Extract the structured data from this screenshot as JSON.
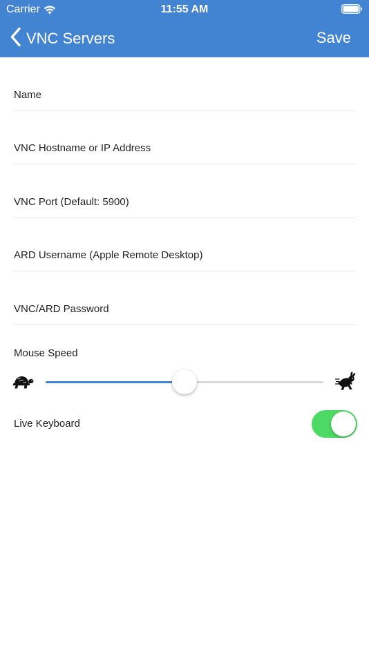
{
  "status_bar": {
    "carrier": "Carrier",
    "time": "11:55 AM",
    "wifi_icon": "wifi-icon",
    "battery_icon": "battery-icon"
  },
  "nav": {
    "back_label": "VNC Servers",
    "back_icon": "chevron-left-icon",
    "save_label": "Save",
    "bar_color": "#4384d2"
  },
  "form": {
    "name": {
      "placeholder": "Name",
      "value": ""
    },
    "hostname": {
      "placeholder": "VNC Hostname or IP Address",
      "value": ""
    },
    "port": {
      "placeholder": "VNC Port (Default: 5900)",
      "value": ""
    },
    "ard_username": {
      "placeholder": "ARD Username (Apple Remote Desktop)",
      "value": ""
    },
    "password": {
      "placeholder": "VNC/ARD Password",
      "value": ""
    }
  },
  "mouse_speed": {
    "label": "Mouse Speed",
    "value": 0.5,
    "min_icon": "turtle-icon",
    "max_icon": "rabbit-icon",
    "fill_color": "#4384d2"
  },
  "live_keyboard": {
    "label": "Live Keyboard",
    "enabled": true,
    "on_color": "#4cd964"
  }
}
